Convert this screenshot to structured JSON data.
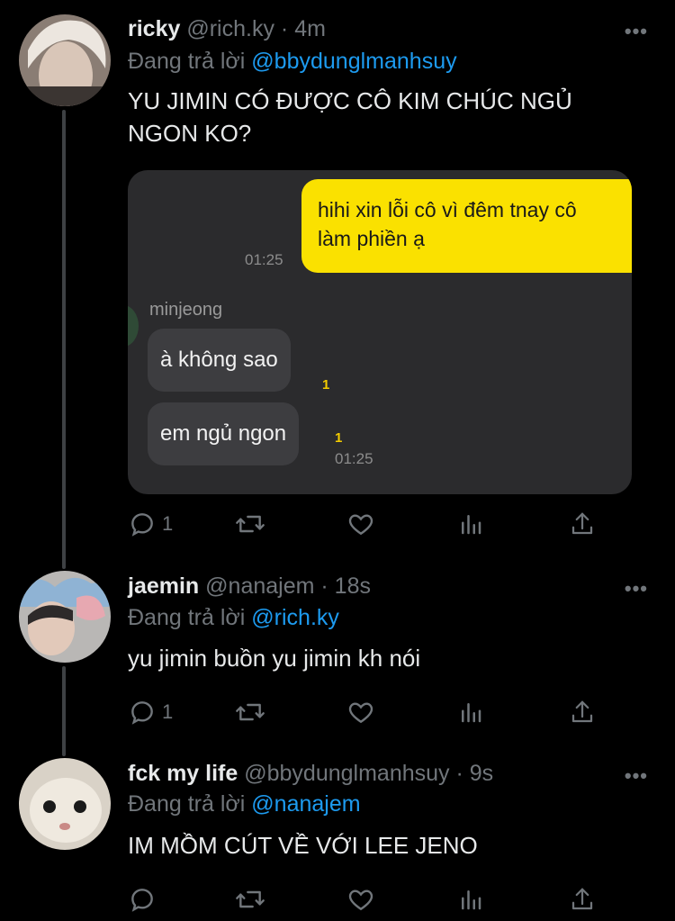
{
  "tweets": [
    {
      "name": "ricky",
      "handle": "@rich.ky",
      "sep": "·",
      "time": "4m",
      "reply_prefix": "Đang trả lời",
      "reply_to": "@bbydunglmanhsuy",
      "text_line1": "YU JIMIN CÓ ĐƯỢC CÔ KIM CHÚC NGỦ",
      "text_line2": "NGON KO?",
      "reply_count": "1",
      "more": "•••"
    },
    {
      "name": "jaemin",
      "handle": "@nanajem",
      "sep": "·",
      "time": "18s",
      "reply_prefix": "Đang trả lời",
      "reply_to": "@rich.ky",
      "text": "yu jimin buồn yu jimin kh nói",
      "reply_count": "1",
      "more": "•••"
    },
    {
      "name": "fck my life",
      "handle": "@bbydunglmanhsuy",
      "sep": "·",
      "time": "9s",
      "reply_prefix": "Đang trả lời",
      "reply_to": "@nanajem",
      "text": "IM MỒM CÚT VỀ VỚI LEE JENO",
      "more": "•••"
    }
  ],
  "chat": {
    "sent_line1": "hihi xin lỗi cô vì đêm tnay cô",
    "sent_line2": "làm phiền ạ",
    "sent_time": "01:25",
    "sender": "minjeong",
    "msg1": "à không sao",
    "msg1_unread": "1",
    "msg2": "em ngủ ngon",
    "msg2_unread": "1",
    "msg2_time": "01:25"
  },
  "icons": {
    "reply": "reply-icon",
    "retweet": "retweet-icon",
    "like": "heart-icon",
    "views": "analytics-icon",
    "share": "share-icon"
  },
  "colors": {
    "background": "#000000",
    "link": "#1d9bf0",
    "muted": "#71767b",
    "chat_bubble": "#fae100"
  }
}
